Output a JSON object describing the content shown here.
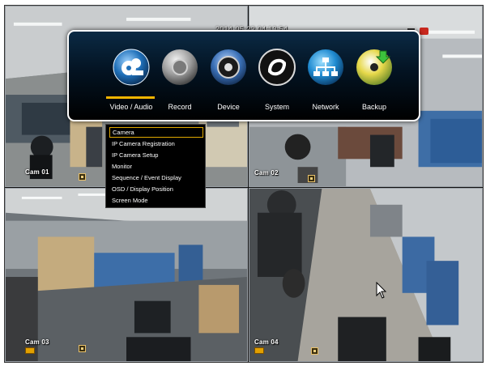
{
  "status_bar": {
    "datetime": "2014-05-22 04:13:54"
  },
  "cameras": [
    {
      "label": "Cam 01"
    },
    {
      "label": "Cam 02"
    },
    {
      "label": "Cam 03"
    },
    {
      "label": "Cam 04"
    }
  ],
  "main_menu": {
    "selected_index": 0,
    "items": [
      {
        "label": "Video / Audio",
        "icon": "video-audio-icon"
      },
      {
        "label": "Record",
        "icon": "record-icon"
      },
      {
        "label": "Device",
        "icon": "device-icon"
      },
      {
        "label": "System",
        "icon": "system-icon"
      },
      {
        "label": "Network",
        "icon": "network-icon"
      },
      {
        "label": "Backup",
        "icon": "backup-icon"
      }
    ]
  },
  "submenu": {
    "items": [
      {
        "label": "Camera",
        "selected": true
      },
      {
        "label": "IP Camera Registration"
      },
      {
        "label": "IP Camera Setup"
      },
      {
        "label": "Monitor"
      },
      {
        "label": "Sequence / Event Display"
      },
      {
        "label": "OSD / Display Position"
      },
      {
        "label": "Screen Mode"
      }
    ]
  },
  "colors": {
    "menu_highlight": "#f0b400",
    "menu_border": "#ffffff",
    "submenu_selected_border": "#e0a800"
  }
}
